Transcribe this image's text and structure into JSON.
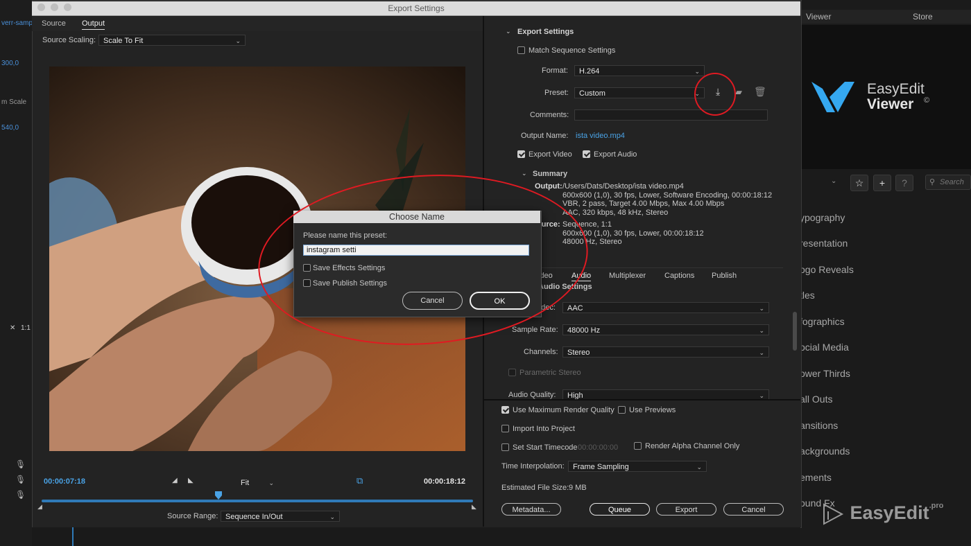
{
  "dialog": {
    "title": "Export Settings",
    "left_tabs": [
      "Source",
      "Output"
    ],
    "source_scaling_label": "Source Scaling:",
    "source_scaling_value": "Scale To Fit",
    "timecode_current": "00:00:07:18",
    "timecode_end": "00:00:18:12",
    "fit_value": "Fit",
    "playhead_fraction": 0.41,
    "source_range_label": "Source Range:",
    "source_range_value": "Sequence In/Out"
  },
  "export_settings": {
    "section_title": "Export Settings",
    "match_sequence": "Match Sequence Settings",
    "format_label": "Format:",
    "format_value": "H.264",
    "preset_label": "Preset:",
    "preset_value": "Custom",
    "comments_label": "Comments:",
    "output_name_label": "Output Name:",
    "output_name_value": "ista video.mp4",
    "export_video": "Export Video",
    "export_audio": "Export Audio",
    "summary_title": "Summary",
    "output_label": "Output:",
    "output_lines": [
      "/Users/Dats/Desktop/ista video.mp4",
      "600x600 (1,0), 30 fps, Lower, Software Encoding, 00:00:18:12",
      "VBR, 2 pass, Target 4.00 Mbps, Max 4.00 Mbps",
      "AAC, 320 kbps, 48 kHz, Stereo"
    ],
    "source_label": "ource:",
    "source_lines": [
      "Sequence, 1:1",
      "600x600 (1,0), 30 fps, Lower, 00:00:18:12",
      "48000 Hz, Stereo"
    ]
  },
  "settings_tabs": [
    "ideo",
    "Audio",
    "Multiplexer",
    "Captions",
    "Publish"
  ],
  "audio": {
    "section_title": "Audio Settings",
    "codec_label": "odec:",
    "codec_value": "AAC",
    "sample_rate_label": "Sample Rate:",
    "sample_rate_value": "48000 Hz",
    "channels_label": "Channels:",
    "channels_value": "Stereo",
    "parametric_stereo": "Parametric Stereo",
    "quality_label": "Audio Quality:",
    "quality_value": "High"
  },
  "bottom": {
    "max_render": "Use Maximum Render Quality",
    "use_previews": "Use Previews",
    "import_project": "Import Into Project",
    "set_start_tc": "Set Start Timecode",
    "start_tc_value": "00:00:00:00",
    "alpha_only": "Render Alpha Channel Only",
    "time_interp_label": "Time Interpolation:",
    "time_interp_value": "Frame Sampling",
    "file_size_label": "Estimated File Size:",
    "file_size_value": "9 MB",
    "metadata_btn": "Metadata...",
    "queue_btn": "Queue",
    "export_btn": "Export",
    "cancel_btn": "Cancel"
  },
  "choose_name": {
    "title": "Choose Name",
    "prompt": "Please name this preset:",
    "input_value": "instagram    setti",
    "save_effects": "Save Effects Settings",
    "save_publish": "Save Publish Settings",
    "cancel": "Cancel",
    "ok": "OK"
  },
  "right_panel": {
    "tabs": [
      "Viewer",
      "Store"
    ],
    "logo_line1": "EasyEdit",
    "logo_line2": "Viewer",
    "logo_mark": "©",
    "search_placeholder": "Search",
    "categories": [
      "ypography",
      "resentation",
      "ogo Reveals",
      "tles",
      "fographics",
      "ocial Media",
      "ower Thirds",
      "all Outs",
      "ansitions",
      "ackgrounds",
      "ements",
      "ound Fx"
    ]
  },
  "background_left": {
    "texts": [
      "verr-samp",
      "300,0",
      "m Scale",
      "540,0",
      "1:1"
    ]
  },
  "watermark": {
    "text": "EasyEdit",
    "suffix": ".pro"
  },
  "colors": {
    "accent_blue": "#4aa3e6",
    "annotation_red": "#e01a22",
    "logo_blue": "#35a8f0"
  }
}
